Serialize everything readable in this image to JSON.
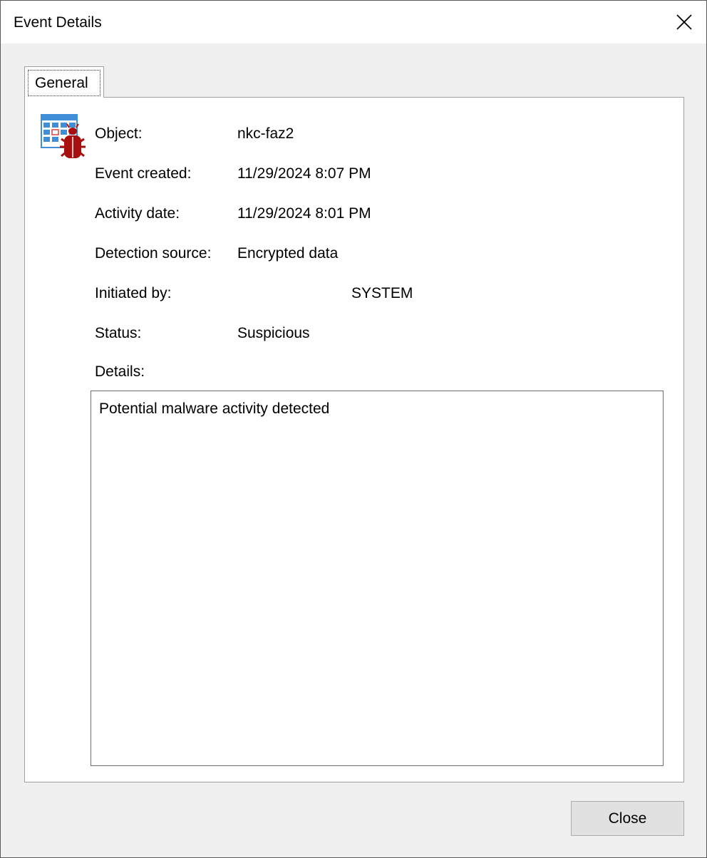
{
  "window": {
    "title": "Event Details",
    "close_icon": "close-icon"
  },
  "tabs": [
    {
      "label": "General",
      "selected": true
    }
  ],
  "general": {
    "icon": "malware-event-icon",
    "fields": {
      "object": {
        "label": "Object:",
        "value": "nkc-faz2"
      },
      "event_created": {
        "label": "Event created:",
        "value": "11/29/2024 8:07 PM"
      },
      "activity_date": {
        "label": "Activity date:",
        "value": "11/29/2024 8:01 PM"
      },
      "detection_source": {
        "label": "Detection source:",
        "value": "Encrypted data"
      },
      "initiated_by": {
        "label": "Initiated by:",
        "value": "SYSTEM"
      },
      "status": {
        "label": "Status:",
        "value": "Suspicious"
      }
    },
    "details": {
      "label": "Details:",
      "text": "Potential malware activity detected"
    }
  },
  "buttons": {
    "close_label": "Close"
  },
  "colors": {
    "bug_red": "#a80f0f",
    "grid_blue": "#3f8fd8"
  }
}
